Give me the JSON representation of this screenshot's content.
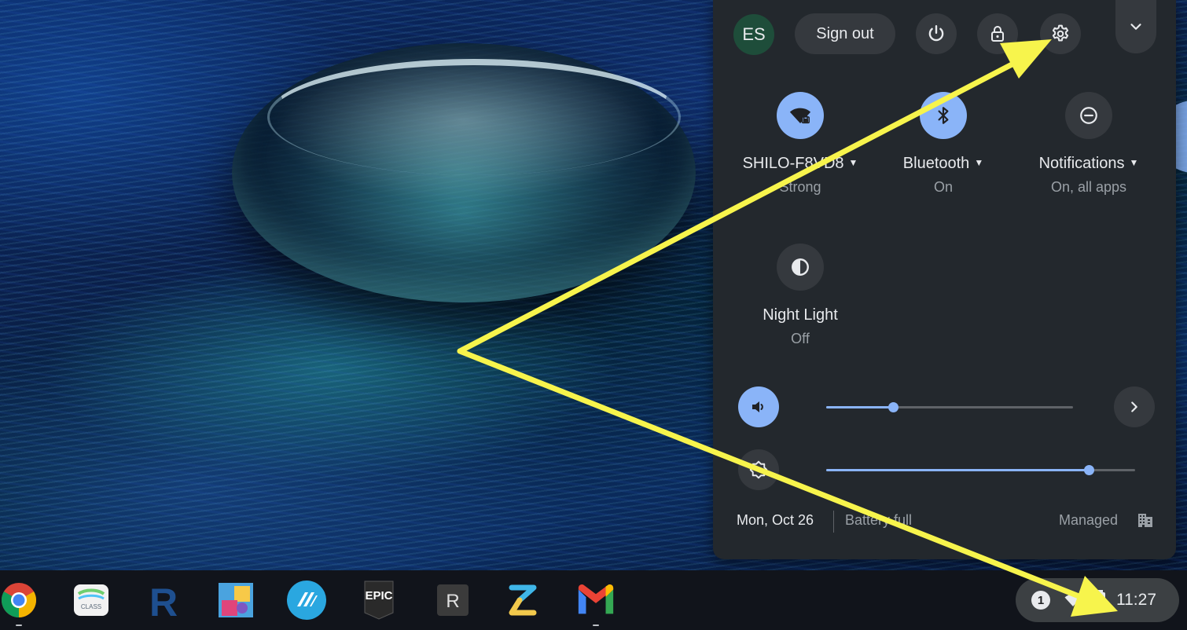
{
  "quick_settings": {
    "avatar_initials": "ES",
    "sign_out_label": "Sign out",
    "icons": {
      "power": "power-icon",
      "lock": "lock-icon",
      "settings": "gear-icon",
      "collapse": "chevron-down-icon"
    },
    "features": [
      {
        "label": "SHILO-F8VD8",
        "sub": "Strong",
        "icon": "wifi-lock-icon",
        "state": "on"
      },
      {
        "label": "Bluetooth",
        "sub": "On",
        "icon": "bluetooth-icon",
        "state": "on"
      },
      {
        "label": "Notifications",
        "sub": "On, all apps",
        "icon": "notifications-icon",
        "state": "off"
      },
      {
        "label": "Night Light",
        "sub": "Off",
        "icon": "night-light-icon",
        "state": "off"
      }
    ],
    "volume_level": 0.27,
    "brightness_level": 0.85,
    "date": "Mon, Oct 26",
    "battery": "Battery full",
    "managed": "Managed"
  },
  "shelf": {
    "apps": [
      {
        "name": "chrome-icon"
      },
      {
        "name": "class-app-icon",
        "label": "CLASS"
      },
      {
        "name": "r-app-icon",
        "label": "R"
      },
      {
        "name": "blocks-app-icon"
      },
      {
        "name": "nearpod-icon"
      },
      {
        "name": "epic-games-icon",
        "label": "EPIC"
      },
      {
        "name": "r-box-app-icon",
        "label": "R"
      },
      {
        "name": "z-app-icon"
      },
      {
        "name": "gmail-icon"
      }
    ],
    "notification_count": "1",
    "time": "11:27"
  },
  "colors": {
    "panel_bg": "#23282d",
    "accent": "#8ab4f8",
    "annotation_arrow": "#f7f44c"
  }
}
